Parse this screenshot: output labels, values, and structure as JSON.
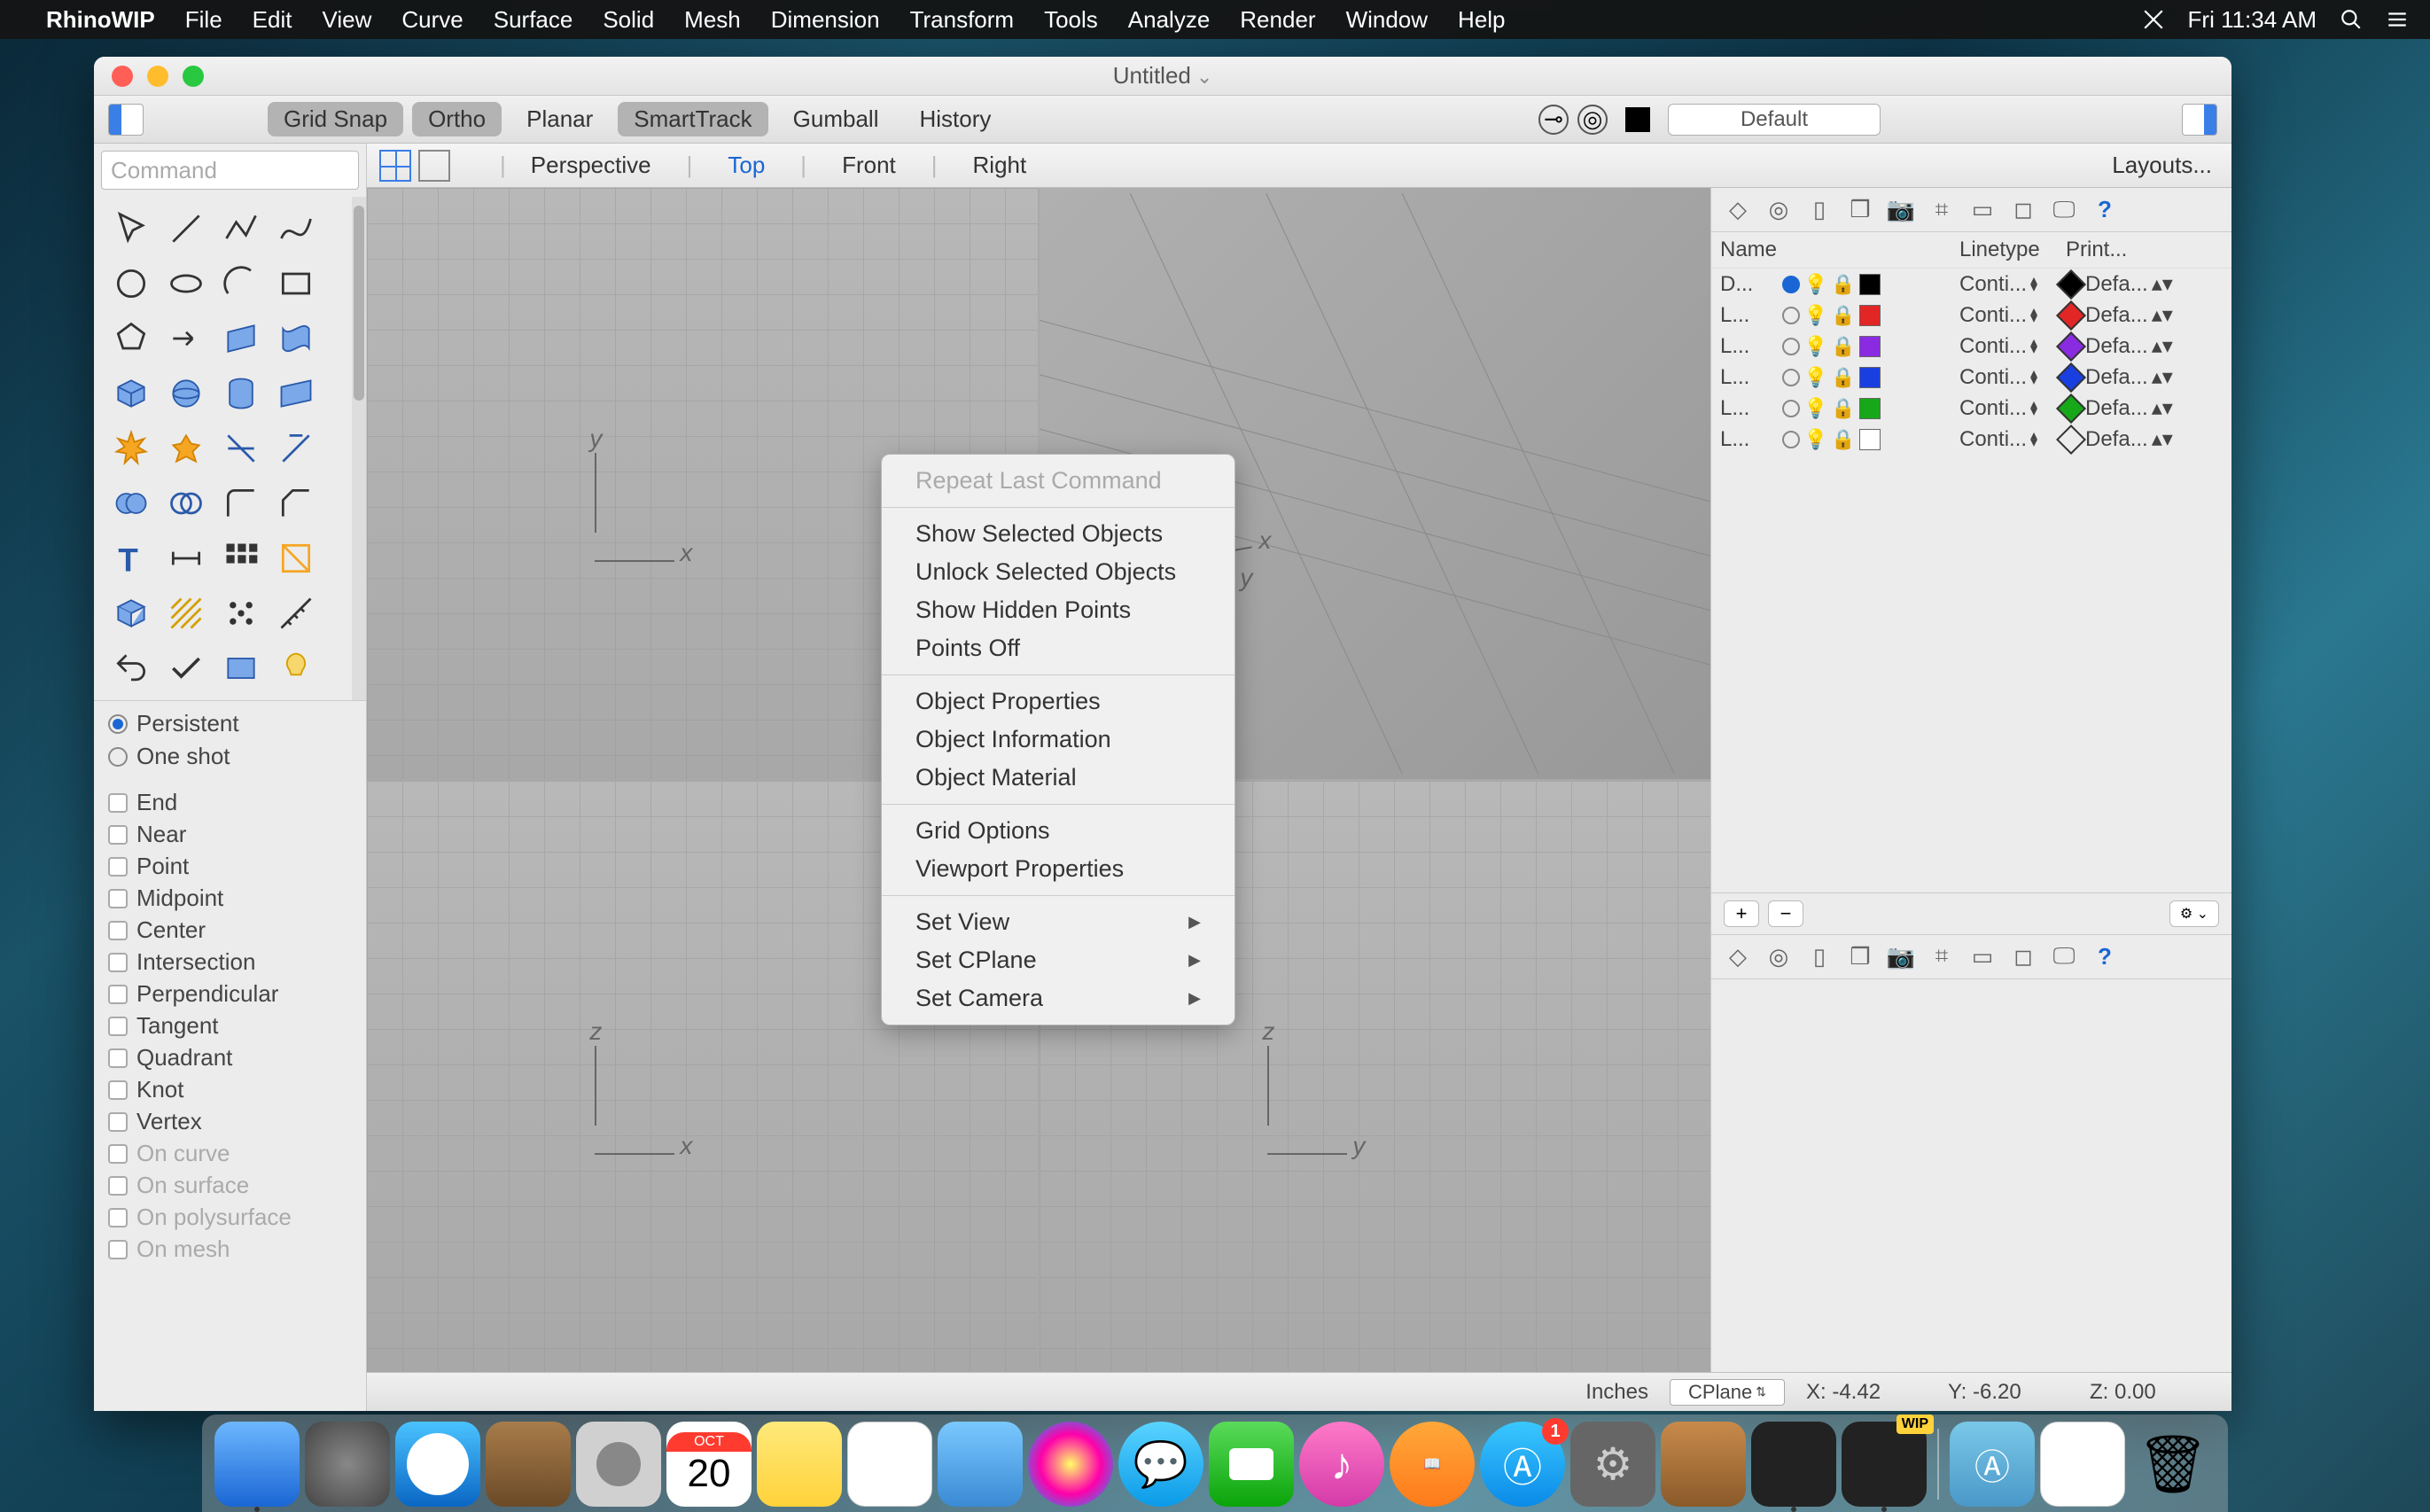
{
  "menubar": {
    "app": "RhinoWIP",
    "items": [
      "File",
      "Edit",
      "View",
      "Curve",
      "Surface",
      "Solid",
      "Mesh",
      "Dimension",
      "Transform",
      "Tools",
      "Analyze",
      "Render",
      "Window",
      "Help"
    ],
    "clock": "Fri 11:34 AM"
  },
  "window": {
    "title": "Untitled"
  },
  "toolbar": {
    "gridsnap": "Grid Snap",
    "ortho": "Ortho",
    "planar": "Planar",
    "smarttrack": "SmartTrack",
    "gumball": "Gumball",
    "history": "History",
    "layer_default": "Default"
  },
  "views": {
    "perspective": "Perspective",
    "top": "Top",
    "front": "Front",
    "right": "Right",
    "layouts": "Layouts..."
  },
  "command_placeholder": "Command",
  "osnap": {
    "persistent": "Persistent",
    "oneshot": "One shot",
    "options": [
      "End",
      "Near",
      "Point",
      "Midpoint",
      "Center",
      "Intersection",
      "Perpendicular",
      "Tangent",
      "Quadrant",
      "Knot",
      "Vertex"
    ],
    "disabled": [
      "On curve",
      "On surface",
      "On polysurface",
      "On mesh"
    ]
  },
  "context_menu": {
    "repeat": "Repeat Last Command",
    "group1": [
      "Show Selected Objects",
      "Unlock Selected Objects",
      "Show Hidden Points",
      "Points Off"
    ],
    "group2": [
      "Object Properties",
      "Object Information",
      "Object Material"
    ],
    "group3": [
      "Grid Options",
      "Viewport Properties"
    ],
    "submenus": [
      "Set View",
      "Set CPlane",
      "Set Camera"
    ]
  },
  "layers": {
    "headers": {
      "name": "Name",
      "linetype": "Linetype",
      "print": "Print..."
    },
    "rows": [
      {
        "name": "D...",
        "current": true,
        "color": "#000000",
        "diam_fill": "#000000",
        "lt": "Conti...",
        "pr": "Defa..."
      },
      {
        "name": "L...",
        "current": false,
        "color": "#e22626",
        "diam_fill": "#e22626",
        "lt": "Conti...",
        "pr": "Defa..."
      },
      {
        "name": "L...",
        "current": false,
        "color": "#8a2be2",
        "diam_fill": "#8a2be2",
        "lt": "Conti...",
        "pr": "Defa..."
      },
      {
        "name": "L...",
        "current": false,
        "color": "#1a3fe0",
        "diam_fill": "#1a3fe0",
        "lt": "Conti...",
        "pr": "Defa..."
      },
      {
        "name": "L...",
        "current": false,
        "color": "#17a81a",
        "diam_fill": "#17a81a",
        "lt": "Conti...",
        "pr": "Defa..."
      },
      {
        "name": "L...",
        "current": false,
        "color": "#ffffff",
        "diam_fill": "transparent",
        "lt": "Conti...",
        "pr": "Defa..."
      }
    ],
    "help_icon": "?"
  },
  "status": {
    "units": "Inches",
    "cplane": "CPlane",
    "x": "X: -4.42",
    "y": "Y: -6.20",
    "z": "Z: 0.00"
  },
  "dock": {
    "badge_count": "1",
    "calendar_month": "OCT",
    "calendar_day": "20",
    "wip_label": "WIP"
  },
  "axes": {
    "x": "x",
    "y": "y",
    "z": "z"
  }
}
